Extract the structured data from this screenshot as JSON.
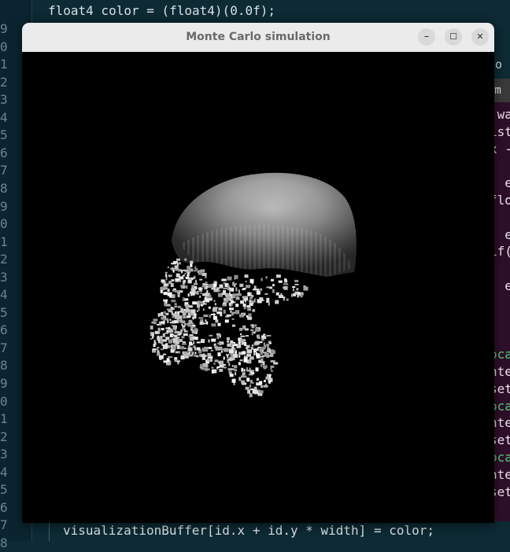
{
  "editor": {
    "line_numbers": [
      "9",
      "0",
      "1",
      "2",
      "3",
      "4",
      "5",
      "6",
      "7",
      "8",
      "9",
      "0",
      "1",
      "2",
      "3",
      "4",
      "5",
      "6",
      "7",
      "8",
      "9",
      "0",
      "1",
      "2",
      "3",
      "4",
      "5",
      "6",
      "7",
      "8"
    ],
    "top_line": "float4 color = (float4)(0.0f);",
    "bottom_line": "visualizationBuffer[id.x + id.y * width] = color;"
  },
  "right_peek": {
    "top_text": "ho",
    "tab_text": "nm",
    "lines": [
      {
        "text": " wa",
        "green": false
      },
      {
        "text": "ist",
        "green": false
      },
      {
        "text": "x -",
        "green": false
      },
      {
        "text": "",
        "green": false
      },
      {
        "text": ": e",
        "green": false
      },
      {
        "text": "flo",
        "green": false
      },
      {
        "text": "",
        "green": false
      },
      {
        "text": ": e",
        "green": false
      },
      {
        "text": "if(",
        "green": false
      },
      {
        "text": "",
        "green": false
      },
      {
        "text": ": e",
        "green": false
      },
      {
        "text": "",
        "green": false
      },
      {
        "text": "",
        "green": false
      },
      {
        "text": "",
        "green": false
      },
      {
        "text": "oca",
        "green": true
      },
      {
        "text": "nte",
        "green": false
      },
      {
        "text": "set",
        "green": false
      },
      {
        "text": "oca",
        "green": true
      },
      {
        "text": "nte",
        "green": false
      },
      {
        "text": "set",
        "green": false
      },
      {
        "text": "oca",
        "green": true
      },
      {
        "text": "nte",
        "green": false
      },
      {
        "text": "set",
        "green": false
      }
    ]
  },
  "window": {
    "title": "Monte Carlo simulation",
    "minimize_glyph": "–",
    "maximize_glyph": "☐",
    "close_glyph": "✕"
  },
  "colors": {
    "editor_bg": "#0d2a35",
    "right_panel_bg": "#2e0f2a",
    "titlebar_bg": "#ebebeb",
    "viewport_bg": "#000000"
  },
  "icons": [
    "minimize-icon",
    "maximize-icon",
    "close-icon"
  ]
}
